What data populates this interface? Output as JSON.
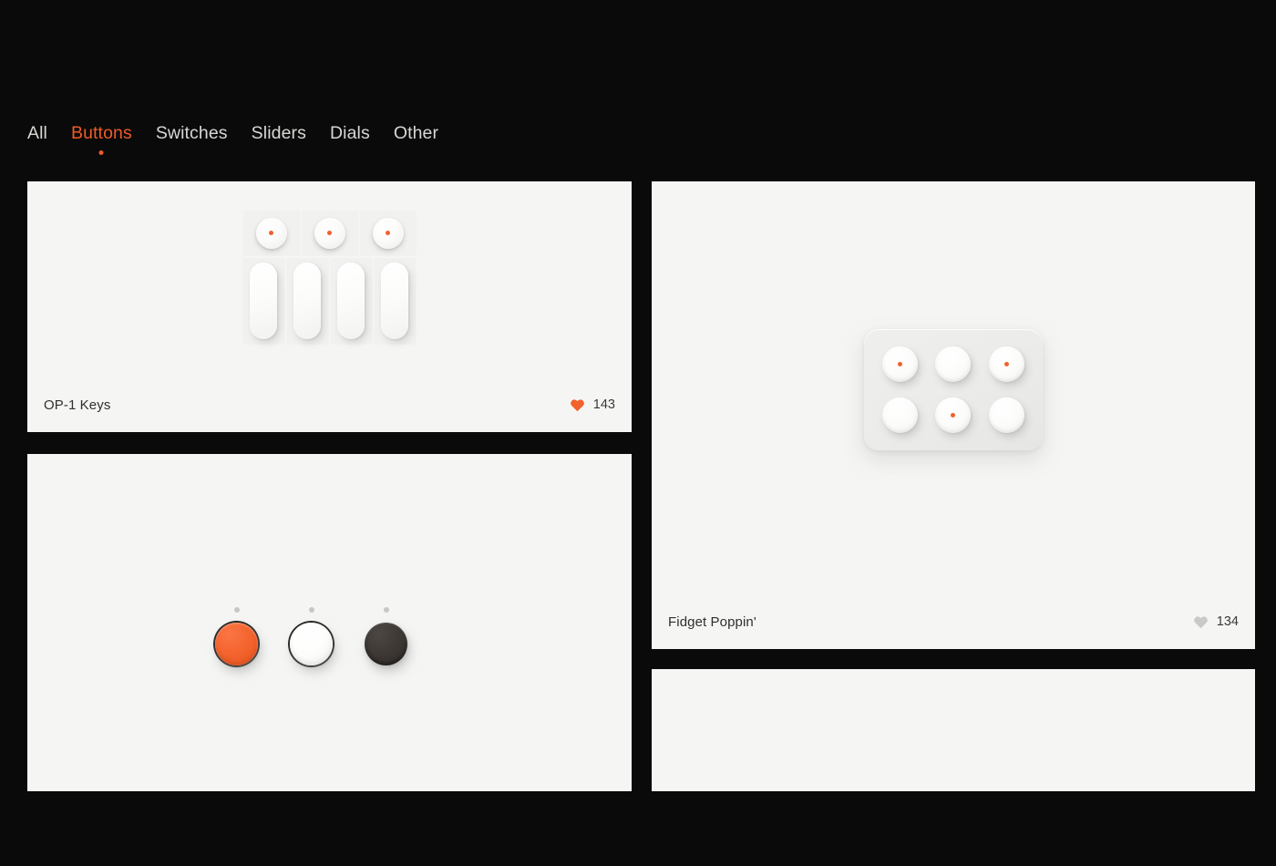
{
  "theme": {
    "background": "#0a0a0a",
    "card_background": "#f5f5f4",
    "accent": "#ee5b2b",
    "nav_inactive": "#d7d7d5",
    "heart_liked": "#f1622c",
    "heart_unliked": "#c9c9c7"
  },
  "nav": {
    "items": [
      {
        "label": "All",
        "active": false
      },
      {
        "label": "Buttons",
        "active": true
      },
      {
        "label": "Switches",
        "active": false
      },
      {
        "label": "Sliders",
        "active": false
      },
      {
        "label": "Dials",
        "active": false
      },
      {
        "label": "Other",
        "active": false
      }
    ]
  },
  "cards": [
    {
      "id": "op1-keys",
      "title": "OP-1 Keys",
      "likes": "143",
      "liked": true,
      "heart_icon": "heart-filled-icon",
      "knob_dots": [
        true,
        true,
        true
      ],
      "key_count": 4
    },
    {
      "id": "fidget-poppin",
      "title": "Fidget Poppin'",
      "likes": "134",
      "liked": false,
      "heart_icon": "heart-icon",
      "button_dots": [
        true,
        false,
        true,
        false,
        true,
        false
      ]
    },
    {
      "id": "round-knobs",
      "title": "",
      "likes": "",
      "liked": false,
      "heart_icon": "",
      "knob_colors": [
        "orange",
        "white",
        "dark"
      ]
    },
    {
      "id": "empty-card",
      "title": "",
      "likes": "",
      "liked": false,
      "heart_icon": ""
    }
  ]
}
